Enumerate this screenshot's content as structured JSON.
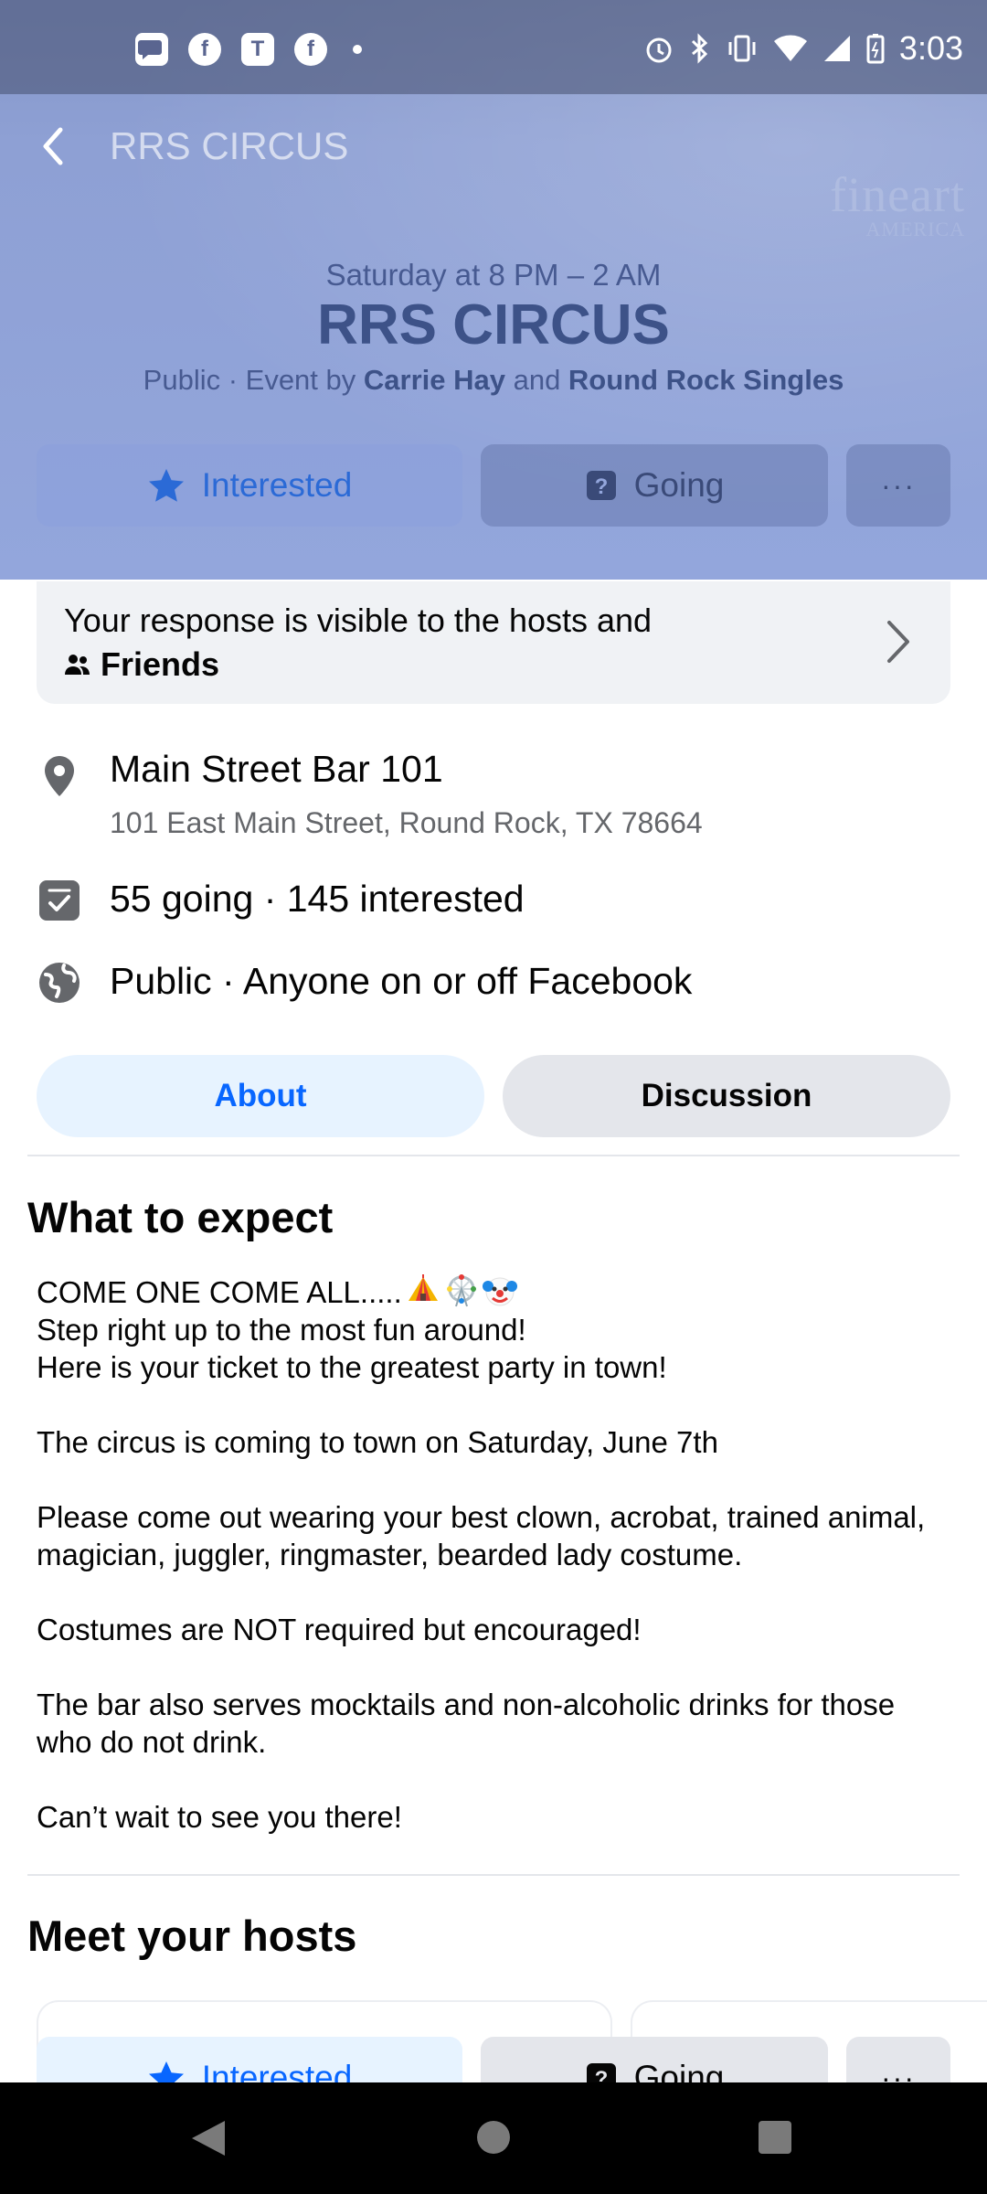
{
  "status_bar": {
    "time": "3:03",
    "icons_left": [
      "chat-bubble-icon",
      "facebook-icon",
      "teams-icon",
      "facebook-icon",
      "notification-dot"
    ],
    "icons_right": [
      "alarm-icon",
      "bluetooth-icon",
      "vibrate-icon",
      "wifi-icon",
      "signal-icon",
      "battery-icon"
    ]
  },
  "header": {
    "title": "RRS CIRCUS",
    "watermark_line1": "fineart",
    "watermark_line2": "AMERICA"
  },
  "event": {
    "when": "Saturday at 8 PM – 2 AM",
    "title": "RRS CIRCUS",
    "byline_prefix": "Public · Event by ",
    "host1": "Carrie Hay",
    "byline_and": " and ",
    "host2": "Round Rock Singles"
  },
  "rsvp": {
    "interested_label": "Interested",
    "going_label": "Going",
    "more_label": "···"
  },
  "response_notice": {
    "text": "Your response is visible to the hosts and",
    "audience": "Friends"
  },
  "details": {
    "venue_name": "Main Street Bar 101",
    "venue_address": "101 East Main Street, Round Rock, TX 78664",
    "attendance": "55 going · 145 interested",
    "privacy": "Public · Anyone on or off Facebook"
  },
  "tabs": {
    "about": "About",
    "discussion": "Discussion"
  },
  "about": {
    "heading": "What to expect",
    "line1": "COME ONE COME ALL.....",
    "line2": "Step right up to the most fun around!",
    "line3": "Here is your ticket to the greatest party in town!",
    "line4": "The circus is coming to town on Saturday, June 7th",
    "line5": "Please come out wearing your best clown, acrobat, trained animal, magician, juggler, ringmaster, bearded lady costume.",
    "line6": "Costumes are NOT required but encouraged!",
    "line7": "The bar also serves mocktails and non-alcoholic drinks for those who do not drink.",
    "line8": "Can’t wait to see you there!"
  },
  "hosts": {
    "heading": "Meet your hosts"
  },
  "colors": {
    "accent": "#0866ff",
    "cover_top": "#8597c9",
    "cover_bottom": "#93a6dc",
    "secondary_text": "#65676b"
  }
}
